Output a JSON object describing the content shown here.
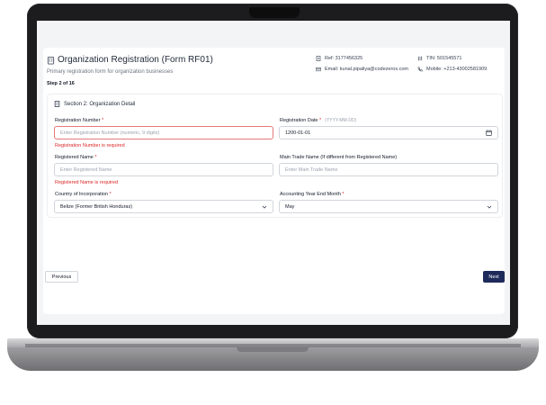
{
  "header": {
    "title": "Organization Registration (Form RF01)",
    "subtitle": "Primary registration form for organization businesses",
    "step": "Step 2 of 16",
    "ref": "Ref: 3177456325",
    "tin": "TIN: 501545571",
    "email": "Email: kunal.pipaliya@codezeros.com",
    "mobile": "Mobile: +213-43002581909"
  },
  "section": {
    "title": "Section 2: Organization Detail"
  },
  "fields": {
    "reg_number": {
      "label": "Registration Number",
      "placeholder": "Enter Registration Number (numeric, 9 digits)",
      "error": "Registration Number is required"
    },
    "reg_date": {
      "label": "Registration Date",
      "hint": "(YYYY-MM-DD)",
      "value": "1200-01-01"
    },
    "reg_name": {
      "label": "Registered Name",
      "placeholder": "Enter Registered Name",
      "error": "Registered Name is required"
    },
    "trade_name": {
      "label": "Main Trade Name (If different from Registered Name)",
      "placeholder": "Enter Main Trade Name"
    },
    "country": {
      "label": "Country of Incorporation",
      "value": "Belize (Former British Honduras)"
    },
    "year_end": {
      "label": "Accounting Year End Month",
      "value": "May"
    }
  },
  "nav": {
    "previous": "Previous",
    "next": "Next"
  },
  "required_marker": "*",
  "colors": {
    "accent": "#1e2a5a",
    "error": "#dc2626"
  }
}
